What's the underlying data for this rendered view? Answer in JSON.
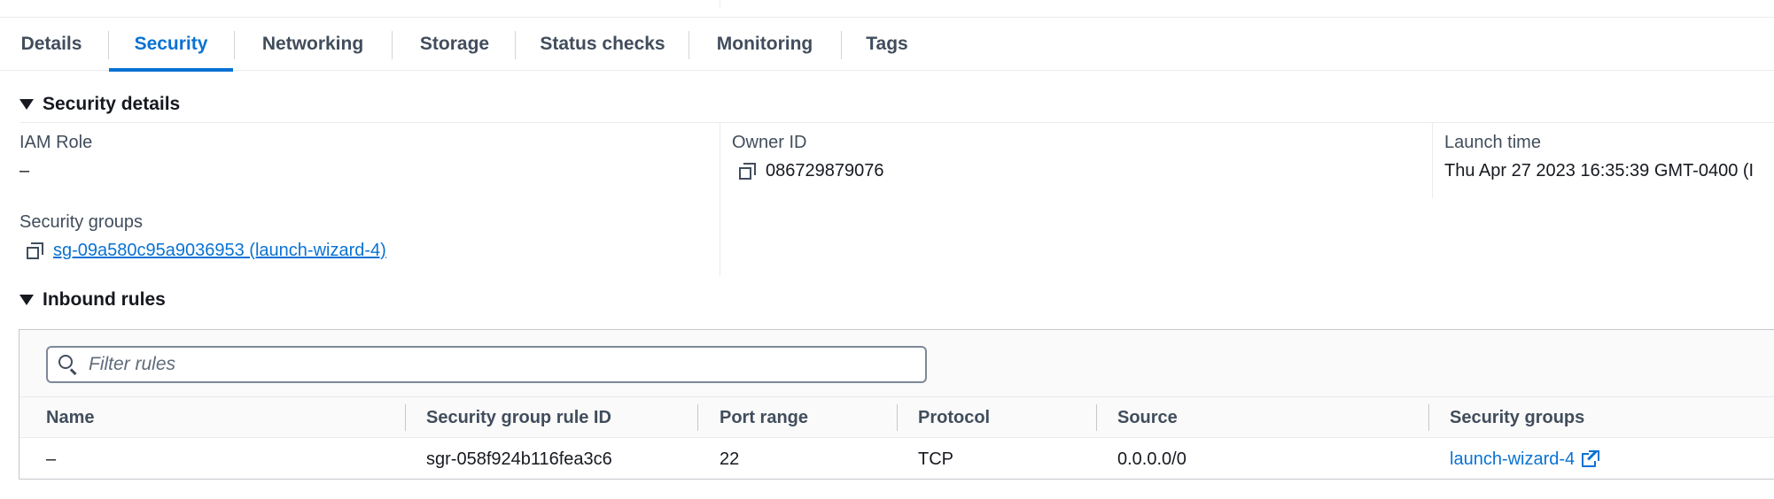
{
  "tabs": [
    {
      "label": "Details"
    },
    {
      "label": "Security"
    },
    {
      "label": "Networking"
    },
    {
      "label": "Storage"
    },
    {
      "label": "Status checks"
    },
    {
      "label": "Monitoring"
    },
    {
      "label": "Tags"
    }
  ],
  "active_tab": "Security",
  "security_details": {
    "title": "Security details",
    "iam_role": {
      "label": "IAM Role",
      "value": "–"
    },
    "owner_id": {
      "label": "Owner ID",
      "value": "086729879076"
    },
    "launch_time": {
      "label": "Launch time",
      "value": "Thu Apr 27 2023 16:35:39 GMT-0400 (I"
    },
    "security_groups": {
      "label": "Security groups",
      "value": "sg-09a580c95a9036953 (launch-wizard-4)"
    }
  },
  "inbound_rules": {
    "title": "Inbound rules",
    "filter_placeholder": "Filter rules",
    "columns": [
      "Name",
      "Security group rule ID",
      "Port range",
      "Protocol",
      "Source",
      "Security groups"
    ],
    "rows": [
      {
        "name": "–",
        "rule_id": "sgr-058f924b116fea3c6",
        "port_range": "22",
        "protocol": "TCP",
        "source": "0.0.0.0/0",
        "security_group": "launch-wizard-4"
      }
    ]
  },
  "colors": {
    "accent": "#0972d3",
    "text": "#16191f",
    "muted": "#414d5c"
  }
}
